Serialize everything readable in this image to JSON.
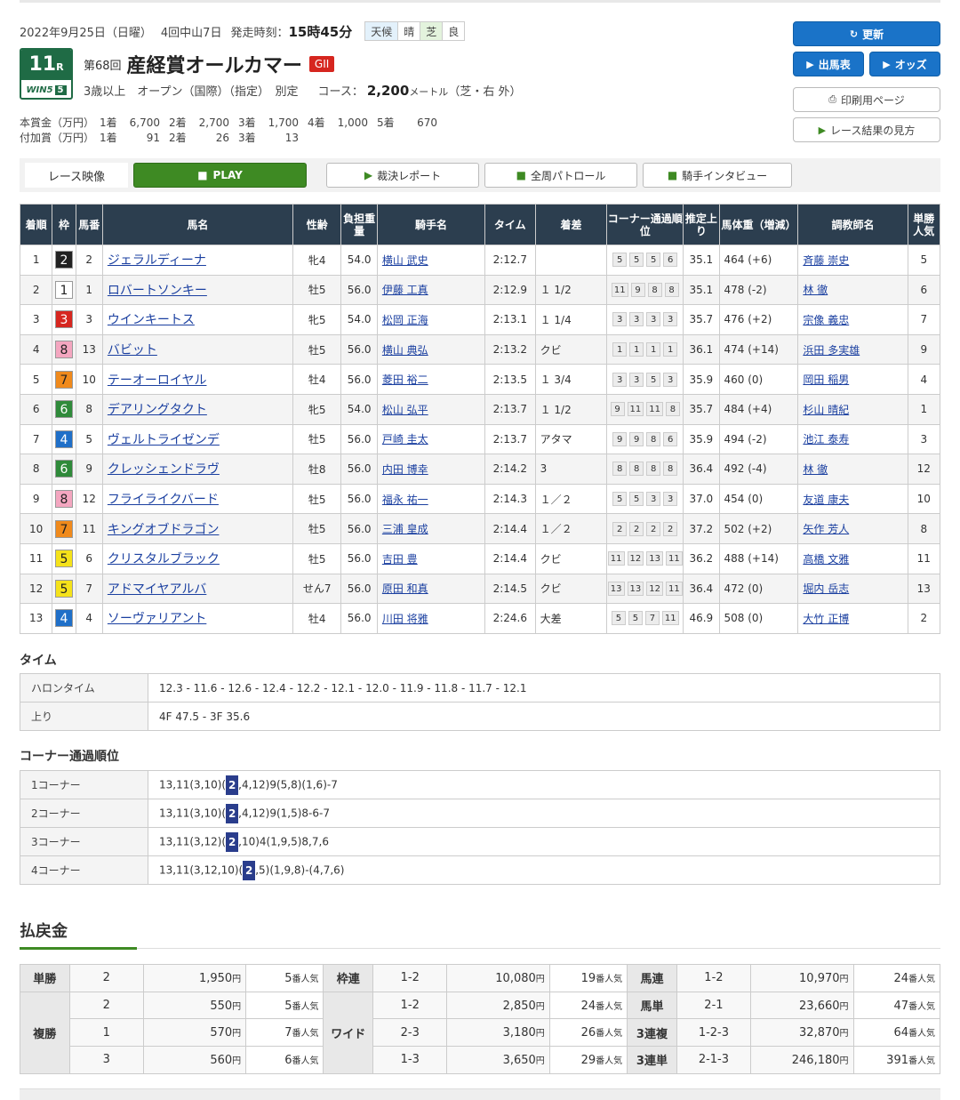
{
  "header": {
    "date": "2022年9月25日（日曜）",
    "meeting": "4回中山7日",
    "start_label": "発走時刻：",
    "start_time": "15時45分",
    "weather_label": "天候",
    "weather": "晴",
    "track_label": "芝",
    "track_cond": "良",
    "race_num": "11",
    "race_suffix": "R",
    "win5": "WIN5",
    "win5_num": "5",
    "kai": "第68回",
    "race_name": "産経賞オールカマー",
    "grade": "GII",
    "conditions": "3歳以上　オープン（国際）（指定）　別定",
    "course_label": "コース：",
    "course_dist": "2,200",
    "course_unit": "メートル",
    "course_detail": "（芝・右 外）"
  },
  "prize": {
    "main_label": "本賞金（万円）",
    "main": [
      [
        "1着",
        "6,700"
      ],
      [
        "2着",
        "2,700"
      ],
      [
        "3着",
        "1,700"
      ],
      [
        "4着",
        "1,000"
      ],
      [
        "5着",
        "670"
      ]
    ],
    "add_label": "付加賞（万円）",
    "add": [
      [
        "1着",
        "91"
      ],
      [
        "2着",
        "26"
      ],
      [
        "3着",
        "13"
      ]
    ]
  },
  "buttons": {
    "refresh": "更新",
    "entries": "出馬表",
    "odds": "オッズ",
    "print": "印刷用ページ",
    "howto": "レース結果の見方"
  },
  "video": {
    "label": "レース映像",
    "play": "PLAY",
    "report": "裁決レポート",
    "patrol": "全周パトロール",
    "interview": "騎手インタビュー"
  },
  "results": {
    "headers": [
      "着順",
      "枠",
      "馬番",
      "馬名",
      "性齢",
      "負担重量",
      "騎手名",
      "タイム",
      "着差",
      "コーナー通過順位",
      "推定上り",
      "馬体重（増減）",
      "調教師名",
      "単勝人気"
    ],
    "rows": [
      {
        "pos": "1",
        "waku": "2",
        "num": "2",
        "horse": "ジェラルディーナ",
        "sex": "牝4",
        "wt": "54.0",
        "jockey": "横山 武史",
        "time": "2:12.7",
        "margin": "",
        "corners": [
          "5",
          "5",
          "5",
          "6"
        ],
        "last": "35.1",
        "bw": "464 (+6)",
        "trainer": "斉藤 崇史",
        "pop": "5"
      },
      {
        "pos": "2",
        "waku": "1",
        "num": "1",
        "horse": "ロバートソンキー",
        "sex": "牡5",
        "wt": "56.0",
        "jockey": "伊藤 工真",
        "time": "2:12.9",
        "margin": "１ 1/2",
        "corners": [
          "11",
          "9",
          "8",
          "8"
        ],
        "last": "35.1",
        "bw": "478 (-2)",
        "trainer": "林 徹",
        "pop": "6"
      },
      {
        "pos": "3",
        "waku": "3",
        "num": "3",
        "horse": "ウインキートス",
        "sex": "牝5",
        "wt": "54.0",
        "jockey": "松岡 正海",
        "time": "2:13.1",
        "margin": "１ 1/4",
        "corners": [
          "3",
          "3",
          "3",
          "3"
        ],
        "last": "35.7",
        "bw": "476 (+2)",
        "trainer": "宗像 義忠",
        "pop": "7"
      },
      {
        "pos": "4",
        "waku": "8",
        "num": "13",
        "horse": "バビット",
        "sex": "牡5",
        "wt": "56.0",
        "jockey": "横山 典弘",
        "time": "2:13.2",
        "margin": "クビ",
        "corners": [
          "1",
          "1",
          "1",
          "1"
        ],
        "last": "36.1",
        "bw": "474 (+14)",
        "trainer": "浜田 多実雄",
        "pop": "9"
      },
      {
        "pos": "5",
        "waku": "7",
        "num": "10",
        "horse": "テーオーロイヤル",
        "sex": "牡4",
        "wt": "56.0",
        "jockey": "菱田 裕二",
        "time": "2:13.5",
        "margin": "１ 3/4",
        "corners": [
          "3",
          "3",
          "5",
          "3"
        ],
        "last": "35.9",
        "bw": "460 (0)",
        "trainer": "岡田 稲男",
        "pop": "4"
      },
      {
        "pos": "6",
        "waku": "6",
        "num": "8",
        "horse": "デアリングタクト",
        "sex": "牝5",
        "wt": "54.0",
        "jockey": "松山 弘平",
        "time": "2:13.7",
        "margin": "１ 1/2",
        "corners": [
          "9",
          "11",
          "11",
          "8"
        ],
        "last": "35.7",
        "bw": "484 (+4)",
        "trainer": "杉山 晴紀",
        "pop": "1"
      },
      {
        "pos": "7",
        "waku": "4",
        "num": "5",
        "horse": "ヴェルトライゼンデ",
        "sex": "牡5",
        "wt": "56.0",
        "jockey": "戸崎 圭太",
        "time": "2:13.7",
        "margin": "アタマ",
        "corners": [
          "9",
          "9",
          "8",
          "6"
        ],
        "last": "35.9",
        "bw": "494 (-2)",
        "trainer": "池江 泰寿",
        "pop": "3"
      },
      {
        "pos": "8",
        "waku": "6",
        "num": "9",
        "horse": "クレッシェンドラヴ",
        "sex": "牡8",
        "wt": "56.0",
        "jockey": "内田 博幸",
        "time": "2:14.2",
        "margin": "3",
        "corners": [
          "8",
          "8",
          "8",
          "8"
        ],
        "last": "36.4",
        "bw": "492 (-4)",
        "trainer": "林 徹",
        "pop": "12"
      },
      {
        "pos": "9",
        "waku": "8",
        "num": "12",
        "horse": "フライライクバード",
        "sex": "牡5",
        "wt": "56.0",
        "jockey": "福永 祐一",
        "time": "2:14.3",
        "margin": "１／２",
        "corners": [
          "5",
          "5",
          "3",
          "3"
        ],
        "last": "37.0",
        "bw": "454 (0)",
        "trainer": "友道 康夫",
        "pop": "10"
      },
      {
        "pos": "10",
        "waku": "7",
        "num": "11",
        "horse": "キングオブドラゴン",
        "sex": "牡5",
        "wt": "56.0",
        "jockey": "三浦 皇成",
        "time": "2:14.4",
        "margin": "１／２",
        "corners": [
          "2",
          "2",
          "2",
          "2"
        ],
        "last": "37.2",
        "bw": "502 (+2)",
        "trainer": "矢作 芳人",
        "pop": "8"
      },
      {
        "pos": "11",
        "waku": "5",
        "num": "6",
        "horse": "クリスタルブラック",
        "sex": "牡5",
        "wt": "56.0",
        "jockey": "吉田 豊",
        "time": "2:14.4",
        "margin": "クビ",
        "corners": [
          "11",
          "12",
          "13",
          "11"
        ],
        "last": "36.2",
        "bw": "488 (+14)",
        "trainer": "高橋 文雅",
        "pop": "11"
      },
      {
        "pos": "12",
        "waku": "5",
        "num": "7",
        "horse": "アドマイヤアルバ",
        "sex": "せん7",
        "wt": "56.0",
        "jockey": "原田 和真",
        "time": "2:14.5",
        "margin": "クビ",
        "corners": [
          "13",
          "13",
          "12",
          "11"
        ],
        "last": "36.4",
        "bw": "472 (0)",
        "trainer": "堀内 岳志",
        "pop": "13"
      },
      {
        "pos": "13",
        "waku": "4",
        "num": "4",
        "horse": "ソーヴァリアント",
        "sex": "牡4",
        "wt": "56.0",
        "jockey": "川田 将雅",
        "time": "2:24.6",
        "margin": "大差",
        "corners": [
          "5",
          "5",
          "7",
          "11"
        ],
        "last": "46.9",
        "bw": "508 (0)",
        "trainer": "大竹 正博",
        "pop": "2"
      }
    ]
  },
  "waku_colors": {
    "1": {
      "bg": "#ffffff",
      "fg": "#222222"
    },
    "2": {
      "bg": "#222222",
      "fg": "#ffffff"
    },
    "3": {
      "bg": "#d6261f",
      "fg": "#ffffff"
    },
    "4": {
      "bg": "#1f6fc8",
      "fg": "#ffffff"
    },
    "5": {
      "bg": "#f5e21a",
      "fg": "#222222"
    },
    "6": {
      "bg": "#2f8a3a",
      "fg": "#ffffff"
    },
    "7": {
      "bg": "#f08a1c",
      "fg": "#222222"
    },
    "8": {
      "bg": "#f4a6c0",
      "fg": "#222222"
    }
  },
  "time_section": {
    "title": "タイム",
    "furlong_label": "ハロンタイム",
    "furlong": "12.3 - 11.6 - 12.6 - 12.4 - 12.2 - 12.1 - 12.0 - 11.9 - 11.8 - 11.7 - 12.1",
    "last_label": "上り",
    "last": "4F 47.5 - 3F 35.6"
  },
  "corner_section": {
    "title": "コーナー通過順位",
    "rows": [
      {
        "label": "1コーナー",
        "pre": "13,11(3,10)(",
        "hl": "2",
        "post": ",4,12)9(5,8)(1,6)-7"
      },
      {
        "label": "2コーナー",
        "pre": "13,11(3,10)(",
        "hl": "2",
        "post": ",4,12)9(1,5)8-6-7"
      },
      {
        "label": "3コーナー",
        "pre": "13,11(3,12)(",
        "hl": "2",
        "post": ",10)4(1,9,5)8,7,6"
      },
      {
        "label": "4コーナー",
        "pre": "13,11(3,12,10)(",
        "hl": "2",
        "post": ",5)(1,9,8)-(4,7,6)"
      }
    ]
  },
  "payout": {
    "title": "払戻金",
    "yen": "円",
    "ninki": "番人気",
    "tansho": {
      "label": "単勝",
      "rows": [
        {
          "c": "2",
          "v": "1,950",
          "p": "5"
        }
      ]
    },
    "fukusho": {
      "label": "複勝",
      "rows": [
        {
          "c": "2",
          "v": "550",
          "p": "5"
        },
        {
          "c": "1",
          "v": "570",
          "p": "7"
        },
        {
          "c": "3",
          "v": "560",
          "p": "6"
        }
      ]
    },
    "wakuren": {
      "label": "枠連",
      "rows": [
        {
          "c": "1-2",
          "v": "10,080",
          "p": "19"
        }
      ]
    },
    "wide": {
      "label": "ワイド",
      "rows": [
        {
          "c": "1-2",
          "v": "2,850",
          "p": "24"
        },
        {
          "c": "2-3",
          "v": "3,180",
          "p": "26"
        },
        {
          "c": "1-3",
          "v": "3,650",
          "p": "29"
        }
      ]
    },
    "umaren": {
      "label": "馬連",
      "c": "1-2",
      "v": "10,970",
      "p": "24"
    },
    "umatan": {
      "label": "馬単",
      "c": "2-1",
      "v": "23,660",
      "p": "47"
    },
    "sanrenpuku": {
      "label": "3連複",
      "c": "1-2-3",
      "v": "32,870",
      "p": "64"
    },
    "sanrentan": {
      "label": "3連単",
      "c": "2-1-3",
      "v": "246,180",
      "p": "391"
    }
  }
}
